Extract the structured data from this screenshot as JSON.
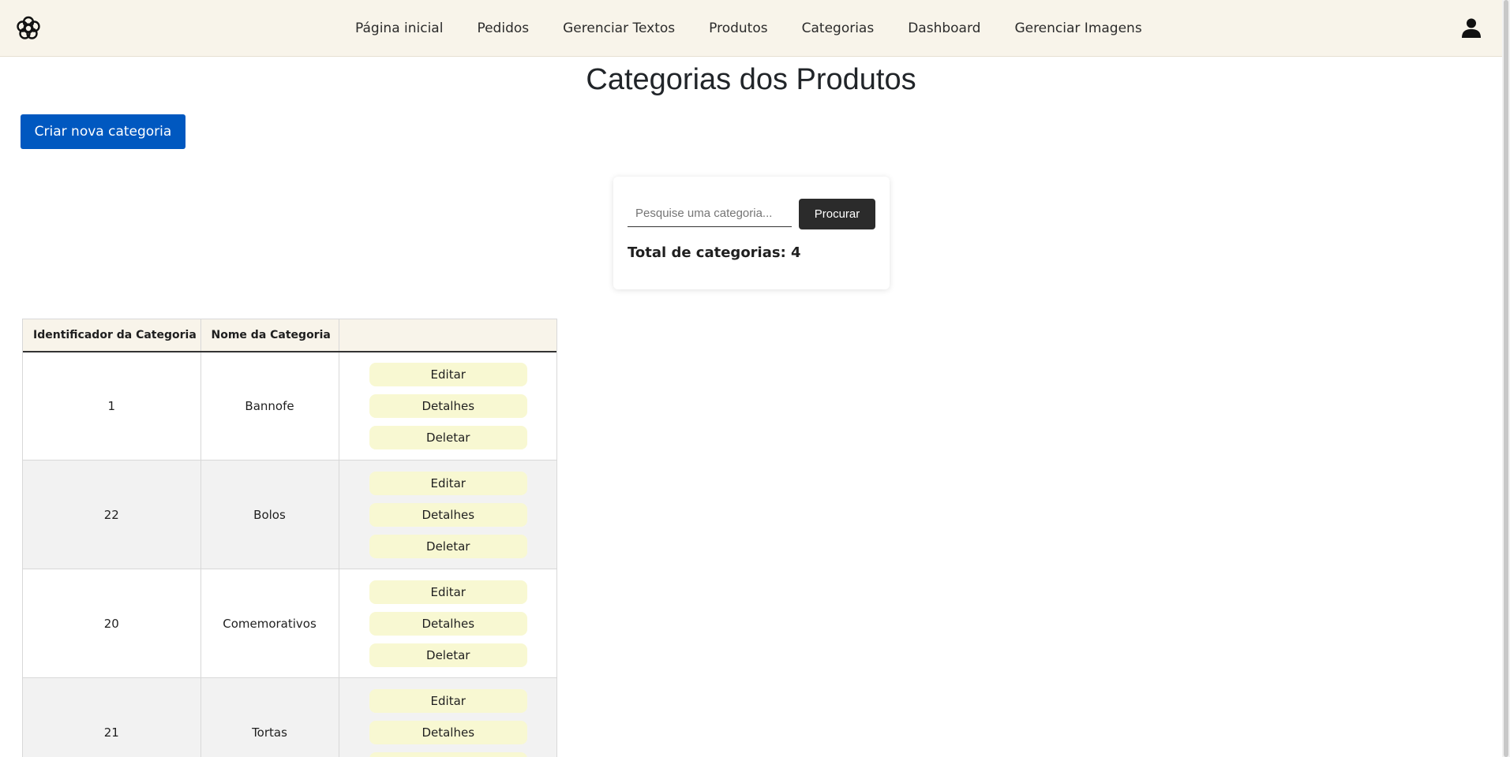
{
  "navbar": {
    "logo_icon": "flower-logo-icon",
    "links": [
      "Página inicial",
      "Pedidos",
      "Gerenciar Textos",
      "Produtos",
      "Categorias",
      "Dashboard",
      "Gerenciar Imagens"
    ],
    "user_icon": "user-icon"
  },
  "page": {
    "title": "Categorias dos Produtos",
    "create_button": "Criar nova categoria"
  },
  "search": {
    "placeholder": "Pesquise uma categoria...",
    "button": "Procurar",
    "total_label": "Total de categorias: 4"
  },
  "table": {
    "headers": [
      "Identificador da Categoria",
      "Nome da Categoria",
      ""
    ],
    "rows": [
      {
        "id": "1",
        "name": "Bannofe"
      },
      {
        "id": "22",
        "name": "Bolos"
      },
      {
        "id": "20",
        "name": "Comemorativos"
      },
      {
        "id": "21",
        "name": "Tortas"
      }
    ],
    "actions": {
      "edit": "Editar",
      "details": "Detalhes",
      "delete": "Deletar"
    }
  },
  "colors": {
    "navbar_bg": "#f8f4ea",
    "primary_button": "#0058c0",
    "dark_button": "#2b2b2b",
    "action_button": "#f8f8d2"
  }
}
